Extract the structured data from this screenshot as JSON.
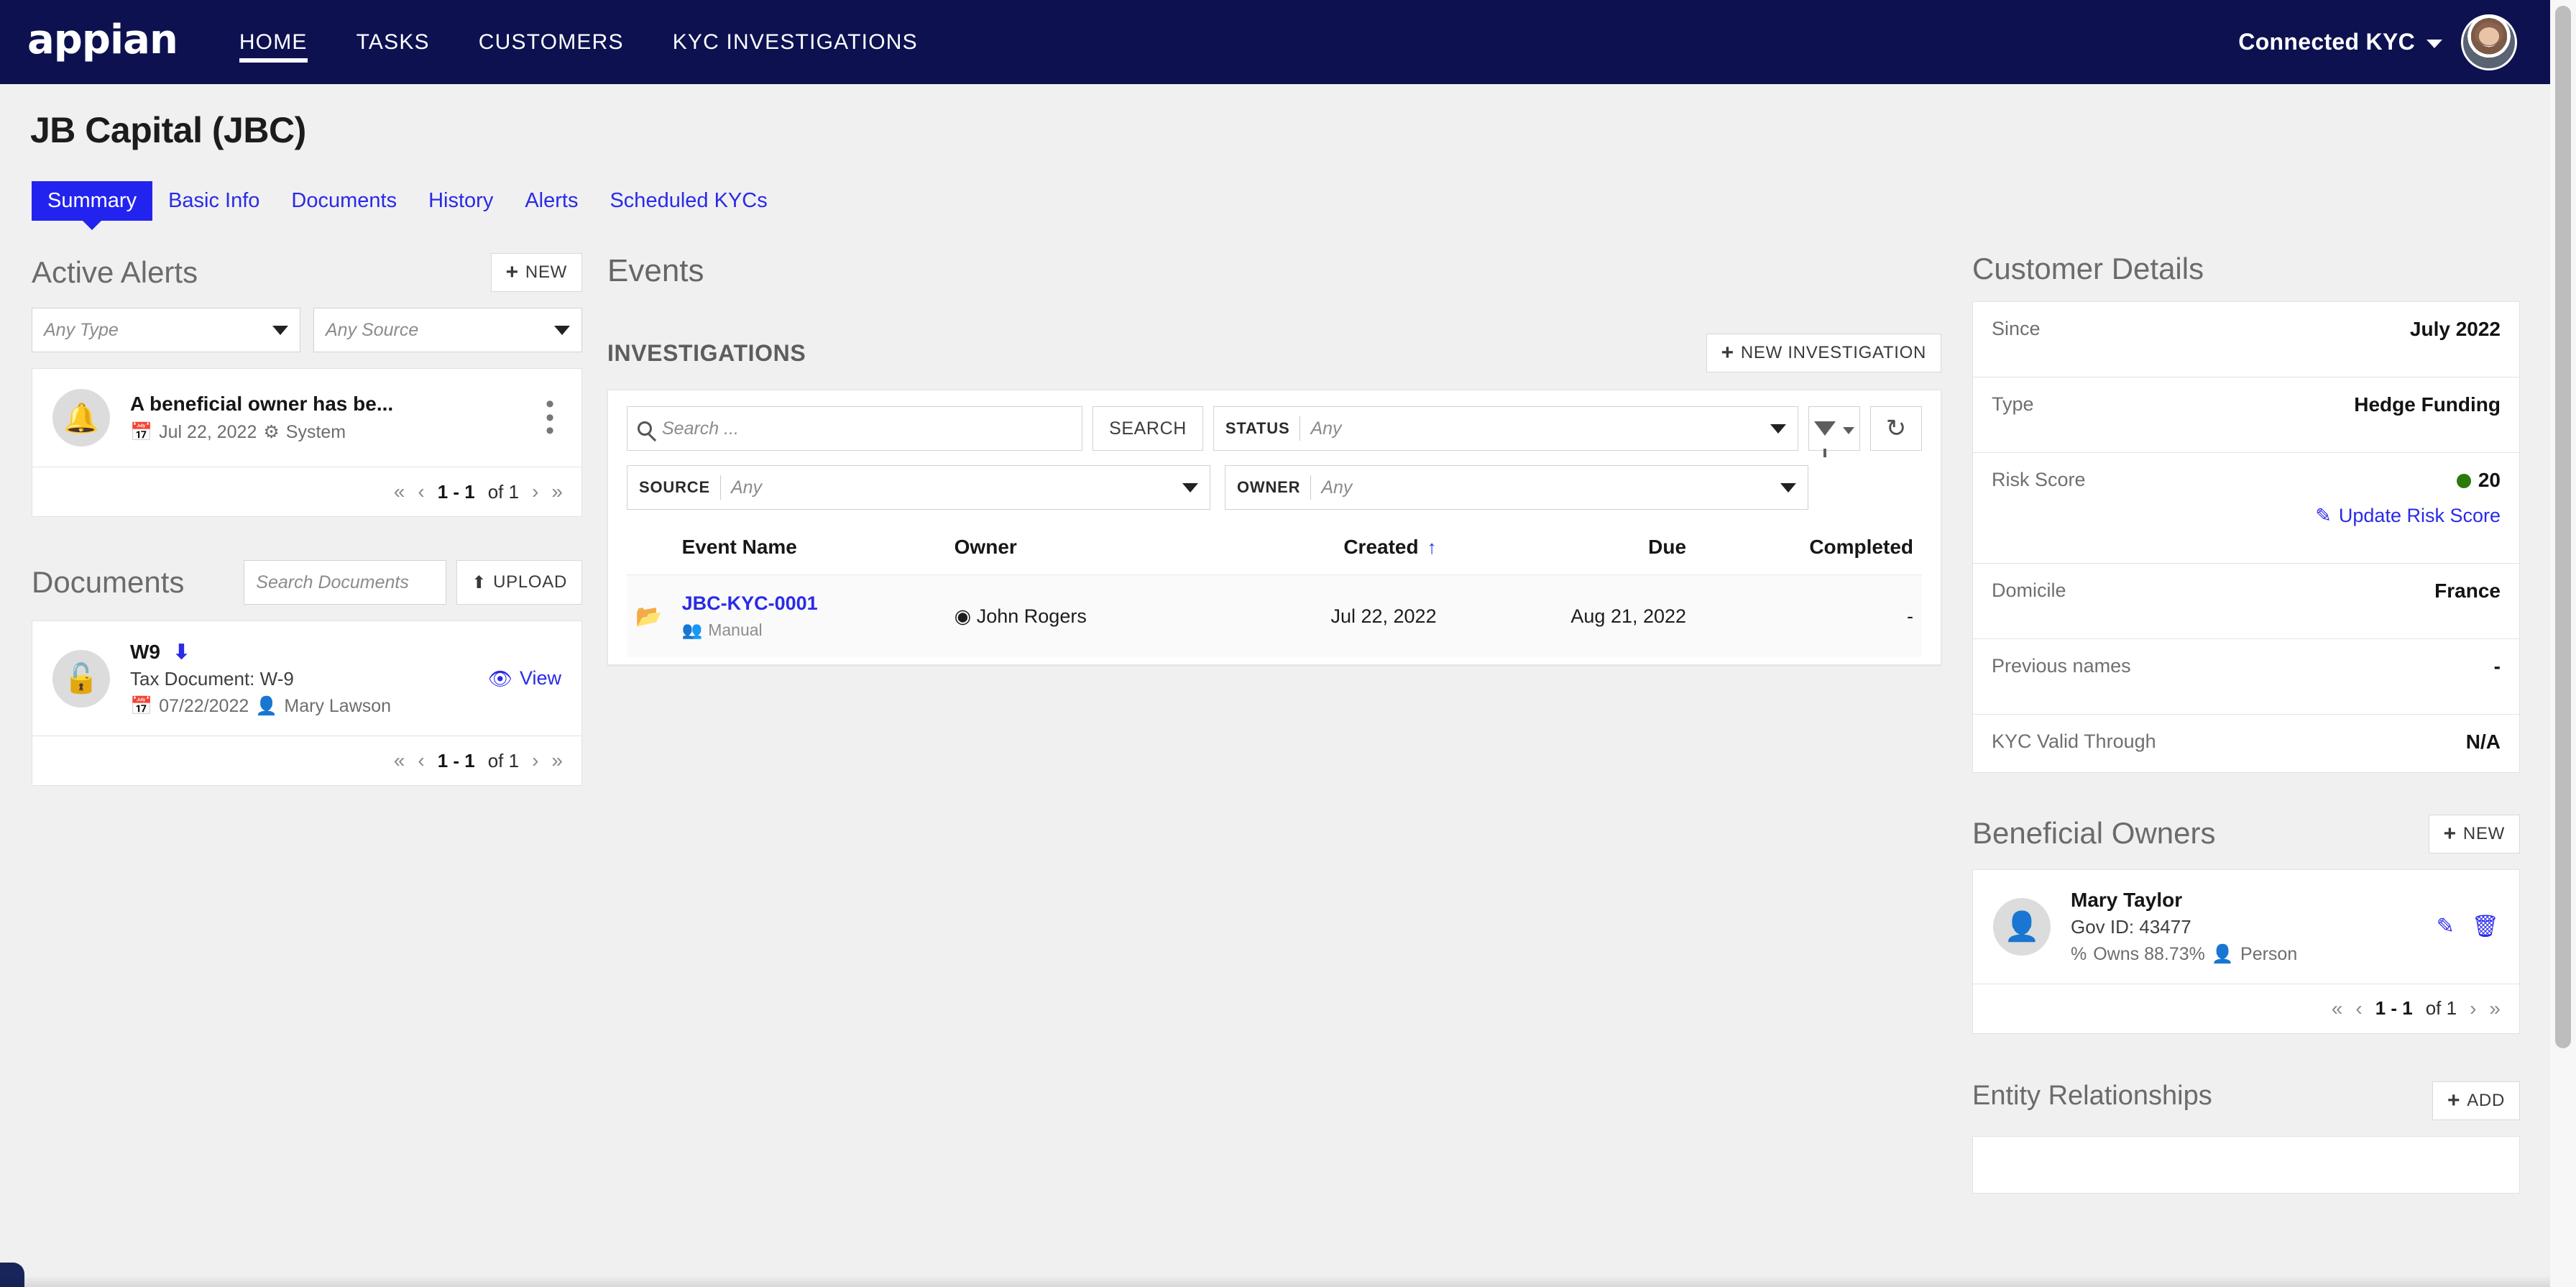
{
  "nav": {
    "logo": "appian",
    "links": [
      {
        "label": "HOME",
        "active": true
      },
      {
        "label": "TASKS",
        "active": false
      },
      {
        "label": "CUSTOMERS",
        "active": false
      },
      {
        "label": "KYC INVESTIGATIONS",
        "active": false
      }
    ],
    "user": "Connected KYC"
  },
  "page": {
    "title": "JB Capital (JBC)",
    "tabs": [
      {
        "label": "Summary",
        "active": true
      },
      {
        "label": "Basic Info",
        "active": false
      },
      {
        "label": "Documents",
        "active": false
      },
      {
        "label": "History",
        "active": false
      },
      {
        "label": "Alerts",
        "active": false
      },
      {
        "label": "Scheduled KYCs",
        "active": false
      }
    ]
  },
  "alerts": {
    "title": "Active Alerts",
    "new_label": "NEW",
    "filter_type_placeholder": "Any Type",
    "filter_source_placeholder": "Any Source",
    "items": [
      {
        "icon": "bell-icon",
        "title": "A beneficial owner has be...",
        "date": "Jul 22, 2022",
        "source": "System"
      }
    ],
    "pager": {
      "range": "1 - 1",
      "of": "of 1"
    }
  },
  "documents": {
    "title": "Documents",
    "search_placeholder": "Search Documents",
    "upload_label": "UPLOAD",
    "items": [
      {
        "icon": "unlock-icon",
        "name": "W9",
        "description": "Tax Document: W-9",
        "date": "07/22/2022",
        "author": "Mary Lawson",
        "view_label": "View"
      }
    ],
    "pager": {
      "range": "1 - 1",
      "of": "of 1"
    }
  },
  "events": {
    "title": "Events",
    "investigations_title": "INVESTIGATIONS",
    "new_investigation_label": "NEW INVESTIGATION",
    "search_placeholder": "Search ...",
    "search_button": "SEARCH",
    "status_label": "STATUS",
    "status_value": "Any",
    "source_label": "SOURCE",
    "source_value": "Any",
    "owner_label": "OWNER",
    "owner_value": "Any",
    "columns": [
      "Event Name",
      "Owner",
      "Created",
      "Due",
      "Completed"
    ],
    "sorted_column": "Created",
    "sort_direction": "ascending",
    "rows": [
      {
        "event_name": "JBC-KYC-0001",
        "event_source": "Manual",
        "owner": "John Rogers",
        "created": "Jul 22, 2022",
        "due": "Aug 21, 2022",
        "completed": "-"
      }
    ]
  },
  "customer_details": {
    "title": "Customer Details",
    "rows": [
      {
        "label": "Since",
        "value": "July 2022"
      },
      {
        "label": "Type",
        "value": "Hedge Funding"
      },
      {
        "label": "Risk Score",
        "value": "20",
        "dot_color": "#2b7a0b",
        "action": "Update Risk Score"
      },
      {
        "label": "Domicile",
        "value": "France"
      },
      {
        "label": "Previous names",
        "value": "-"
      },
      {
        "label": "KYC Valid Through",
        "value": "N/A"
      }
    ]
  },
  "beneficial_owners": {
    "title": "Beneficial Owners",
    "new_label": "NEW",
    "items": [
      {
        "name": "Mary Taylor",
        "gov_id": "Gov ID: 43477",
        "ownership": "Owns 88.73%",
        "type": "Person"
      }
    ],
    "pager": {
      "range": "1 - 1",
      "of": "of 1"
    }
  },
  "entity_relationships": {
    "title": "Entity Relationships",
    "add_label": "ADD"
  },
  "colors": {
    "nav_bg": "#0d1150",
    "accent_blue": "#2a2ae8",
    "active_tab": "#2323ef",
    "risk_green": "#2b7a0b",
    "page_bg": "#f0f0f0"
  }
}
